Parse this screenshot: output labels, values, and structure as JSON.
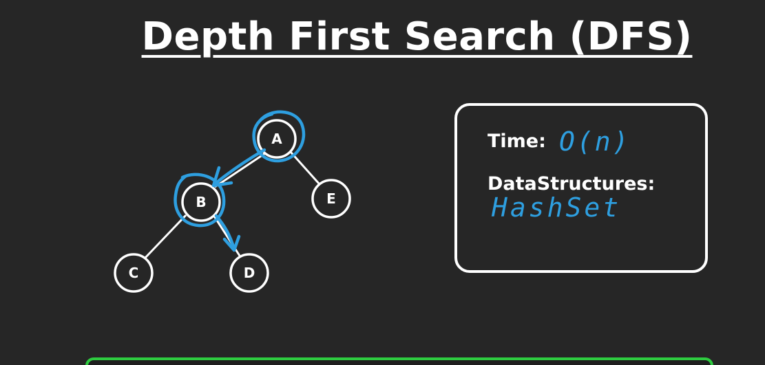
{
  "title": "Depth First Search (DFS)",
  "graph": {
    "nodes": [
      {
        "id": "A",
        "label": "A"
      },
      {
        "id": "B",
        "label": "B"
      },
      {
        "id": "E",
        "label": "E"
      },
      {
        "id": "C",
        "label": "C"
      },
      {
        "id": "D",
        "label": "D"
      }
    ],
    "edges": [
      {
        "from": "A",
        "to": "B"
      },
      {
        "from": "A",
        "to": "E"
      },
      {
        "from": "B",
        "to": "C"
      },
      {
        "from": "B",
        "to": "D"
      }
    ],
    "visited": [
      "A",
      "B"
    ],
    "traversal_arrows": [
      {
        "from": "A",
        "to": "B"
      },
      {
        "from": "B",
        "to": "D"
      }
    ]
  },
  "info": {
    "time_label": "Time:",
    "time_value": "O(n)",
    "ds_label": "DataStructures:",
    "ds_value": "HashSet"
  },
  "colors": {
    "background": "#262626",
    "foreground": "#ffffff",
    "annotation": "#2e9fe0",
    "bottom_bar": "#2ecc40"
  }
}
